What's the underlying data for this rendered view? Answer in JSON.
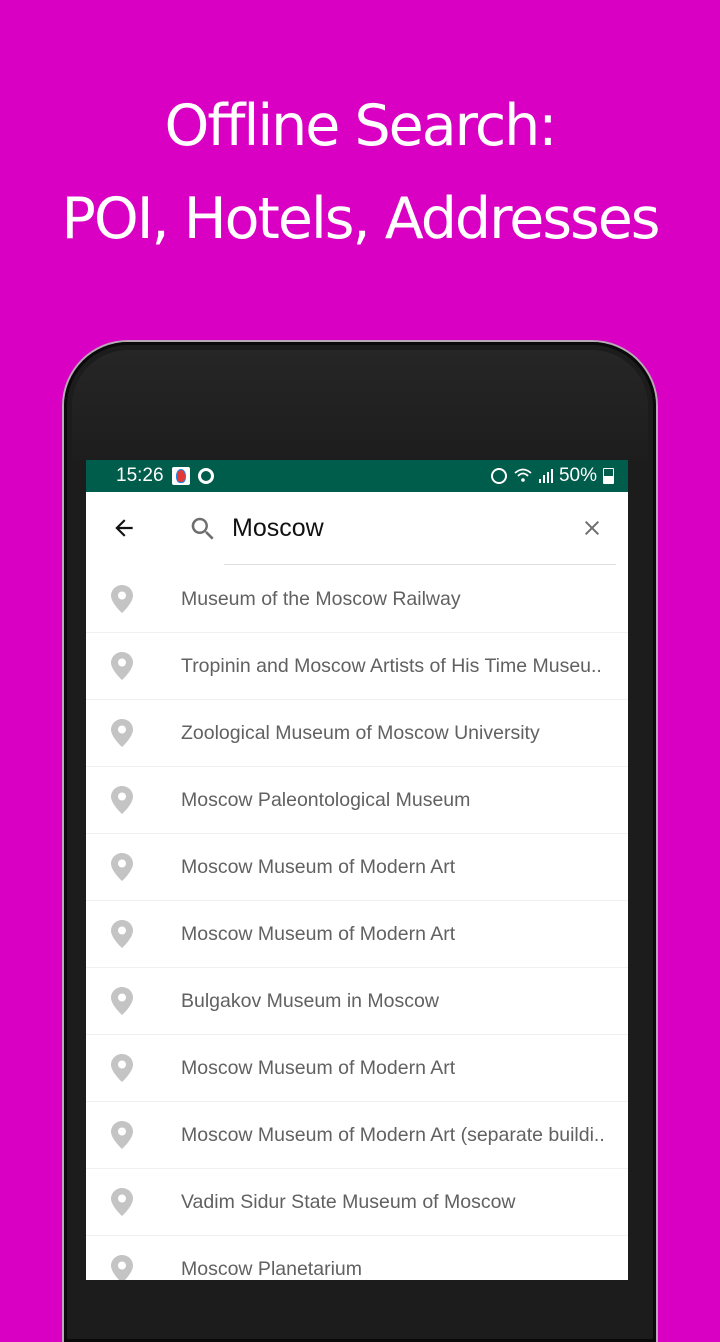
{
  "headline": {
    "line1": "Offline Search:",
    "line2": "POI, Hotels, Addresses"
  },
  "status_bar": {
    "time": "15:26",
    "left_icons": [
      "app-notification-icon",
      "q-app-icon"
    ],
    "right_icons": [
      "alarm-icon",
      "wifi-icon",
      "signal-icon",
      "battery-charging-icon"
    ],
    "battery_percent": "50%"
  },
  "search": {
    "query": "Moscow",
    "back_icon": "arrow-left-icon",
    "search_icon": "search-icon",
    "clear_icon": "close-icon"
  },
  "results": [
    {
      "label": "Museum of the Moscow Railway",
      "icon": "map-pin-icon"
    },
    {
      "label": "Tropinin and Moscow Artists of His Time Museu..",
      "icon": "map-pin-icon"
    },
    {
      "label": "Zoological Museum of Moscow University",
      "icon": "map-pin-icon"
    },
    {
      "label": "Moscow Paleontological Museum",
      "icon": "map-pin-icon"
    },
    {
      "label": "Moscow Museum of Modern Art",
      "icon": "map-pin-icon"
    },
    {
      "label": "Moscow Museum of Modern Art",
      "icon": "map-pin-icon"
    },
    {
      "label": "Bulgakov Museum in Moscow",
      "icon": "map-pin-icon"
    },
    {
      "label": "Moscow Museum of Modern Art",
      "icon": "map-pin-icon"
    },
    {
      "label": "Moscow Museum of Modern Art (separate buildi..",
      "icon": "map-pin-icon"
    },
    {
      "label": "Vadim Sidur State Museum of Moscow",
      "icon": "map-pin-icon"
    },
    {
      "label": "Moscow Planetarium",
      "icon": "map-pin-icon"
    }
  ],
  "colors": {
    "background": "#d900c4",
    "status_bar": "#005c4b",
    "pin": "#c4c4c4",
    "result_text": "#616161"
  }
}
